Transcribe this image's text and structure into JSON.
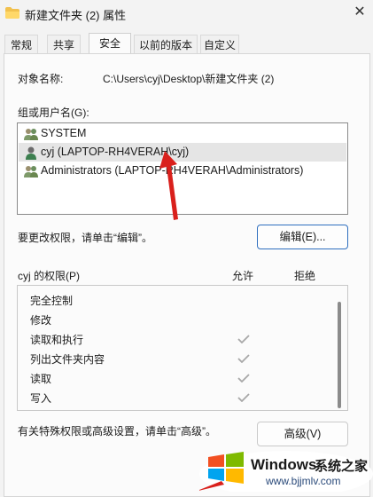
{
  "window": {
    "title": "新建文件夹 (2) 属性",
    "close_label": "✕"
  },
  "tabs": [
    {
      "label": "常规",
      "active": false
    },
    {
      "label": "共享",
      "active": false
    },
    {
      "label": "安全",
      "active": true
    },
    {
      "label": "以前的版本",
      "active": false
    },
    {
      "label": "自定义",
      "active": false
    }
  ],
  "security": {
    "object_name_label": "对象名称:",
    "object_name_value": "C:\\Users\\cyj\\Desktop\\新建文件夹 (2)",
    "groups_label": "组或用户名(G):",
    "users": [
      {
        "name": "SYSTEM",
        "icon": "group-users-icon",
        "selected": false
      },
      {
        "name": "cyj (LAPTOP-RH4VERAH\\cyj)",
        "icon": "user-icon",
        "selected": true
      },
      {
        "name": "Administrators (LAPTOP-RH4VERAH\\Administrators)",
        "icon": "group-users-icon",
        "selected": false
      }
    ],
    "change_hint": "要更改权限，请单击“编辑”。",
    "edit_button": "编辑(E)...",
    "permissions_for": "cyj 的权限(P)",
    "allow_header": "允许",
    "deny_header": "拒绝",
    "permissions": [
      {
        "name": "完全控制",
        "allow": false,
        "deny": false
      },
      {
        "name": "修改",
        "allow": false,
        "deny": false
      },
      {
        "name": "读取和执行",
        "allow": true,
        "deny": false
      },
      {
        "name": "列出文件夹内容",
        "allow": true,
        "deny": false
      },
      {
        "name": "读取",
        "allow": true,
        "deny": false
      },
      {
        "name": "写入",
        "allow": true,
        "deny": false
      }
    ],
    "advanced_hint": "有关特殊权限或高级设置，请单击“高级”。",
    "advanced_button": "高级(V)"
  },
  "watermark": {
    "brand": "Windows",
    "sub": "系统之家",
    "url": "www.bjjmlv.com"
  },
  "colors": {
    "accent": "#2f6fbf",
    "annotation_arrow": "#d9201c"
  }
}
